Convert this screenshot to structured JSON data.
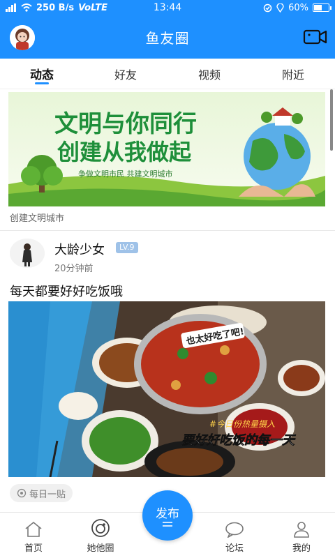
{
  "status_bar": {
    "network": "250 B/s",
    "volte": "VoLTE",
    "time": "13:44",
    "battery": "60%",
    "battery_fraction": 0.6
  },
  "header": {
    "title": "鱼友圈",
    "left_icon": "avatar",
    "right_icon": "video-camera-icon"
  },
  "tabs": [
    {
      "label": "动态",
      "active": true
    },
    {
      "label": "好友",
      "active": false
    },
    {
      "label": "视频",
      "active": false
    },
    {
      "label": "附近",
      "active": false
    }
  ],
  "banner": {
    "headline_1": "文明与你同行",
    "headline_2": "创建从我做起",
    "slogan": "争做文明市民 共建文明城市",
    "caption": "创建文明城市"
  },
  "post": {
    "username": "大龄少女",
    "level": "LV.9",
    "time": "20分钟前",
    "text": "每天都要好好吃饭哦",
    "photo_overlay_1": "也太好吃了吧!",
    "photo_overlay_2": "#今日份热量摄入",
    "photo_overlay_3": "要好好吃饭的每一天",
    "tag": "每日一贴"
  },
  "bottom_nav": {
    "home": "首页",
    "her_circle": "她他圈",
    "publish": "发布",
    "forum": "论坛",
    "mine": "我的"
  },
  "colors": {
    "brand": "#1e90ff",
    "level_badge": "#9fc2e8"
  }
}
